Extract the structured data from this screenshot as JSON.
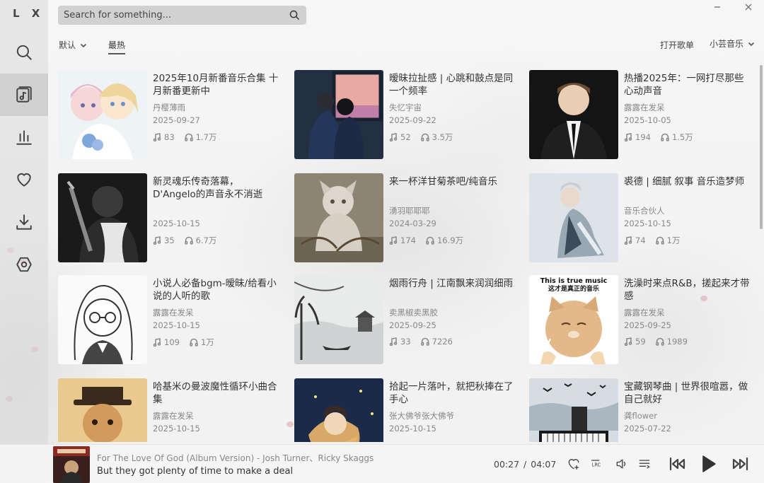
{
  "app": {
    "logo": "L X"
  },
  "sidebar": {
    "items": [
      {
        "name": "search",
        "icon": "search-icon"
      },
      {
        "name": "songlist",
        "icon": "music-note-icon",
        "active": true
      },
      {
        "name": "leaderboard",
        "icon": "bar-chart-icon"
      },
      {
        "name": "favorites",
        "icon": "heart-icon"
      },
      {
        "name": "download",
        "icon": "download-icon"
      },
      {
        "name": "settings",
        "icon": "settings-icon"
      }
    ]
  },
  "search": {
    "placeholder": "Search for something..."
  },
  "filters": {
    "sort_label": "默认",
    "tab_hot": "最热",
    "open_list": "打开歌单",
    "source": "小芸音乐"
  },
  "playlists": [
    {
      "title": "2025年10月新番音乐合集 十月新番更新中",
      "author": "丹樱薄雨",
      "date": "2025-09-27",
      "songs": "83",
      "plays": "1.7万"
    },
    {
      "title": "暧昧拉扯感 | 心跳和鼓点是同一个频率",
      "author": "失忆宇宙",
      "date": "2025-09-22",
      "songs": "52",
      "plays": "3.5万"
    },
    {
      "title": "热播2025年：一网打尽那些心动声音",
      "author": "露露在发呆",
      "date": "2025-10-05",
      "songs": "194",
      "plays": "1.5万"
    },
    {
      "title": "新灵魂乐传奇落幕，D'Angelo的声音永不消逝",
      "author": "",
      "date": "2025-10-15",
      "songs": "35",
      "plays": "6.7万"
    },
    {
      "title": "来一杯洋甘菊茶吧/纯音乐",
      "author": "湧羽耶耶耶",
      "date": "2024-03-29",
      "songs": "174",
      "plays": "16.9万"
    },
    {
      "title": "裘德 | 细腻 叙事 音乐造梦师",
      "author": "音乐合伙人",
      "date": "2025-10-15",
      "songs": "74",
      "plays": "1万"
    },
    {
      "title": "小说人必备bgm-暧昧/给看小说的人听的歌",
      "author": "露露在发呆",
      "date": "2025-10-15",
      "songs": "109",
      "plays": "1万"
    },
    {
      "title": "烟雨行舟 | 江南飘来润润细雨",
      "author": "卖黑椒卖黑胶",
      "date": "2025-09-25",
      "songs": "33",
      "plays": "7226"
    },
    {
      "title": "洗澡时来点R&B，搓起来才带感",
      "author": "露露在发呆",
      "date": "2025-09-25",
      "songs": "59",
      "plays": "1989"
    },
    {
      "title": "哈基米の曼波魔性循环小曲合集",
      "author": "露露在发呆",
      "date": "2025-10-15",
      "songs": "",
      "plays": ""
    },
    {
      "title": "拾起一片落叶，就把秋捧在了手心",
      "author": "张大佛爷张大佛爷",
      "date": "2025-10-15",
      "songs": "",
      "plays": ""
    },
    {
      "title": "宝藏钢琴曲 | 世界很喧嚣，做自己就好",
      "author": "龚flower",
      "date": "2025-07-22",
      "songs": "",
      "plays": ""
    }
  ],
  "covers": {
    "cat_text_1": "This is true music",
    "cat_text_2": "这才是真正的音乐"
  },
  "player": {
    "song": "For The Love Of God (Album Version) - Josh Turner、Ricky Skaggs",
    "lyric": "But they got plenty of time to make a deal",
    "current": "00:27",
    "separator": "/",
    "total": "04:07",
    "lrc_label": "LRC"
  },
  "colors": {
    "accent": "#333333",
    "muted": "#888888",
    "sidebar_active": "#c8c8c8"
  }
}
